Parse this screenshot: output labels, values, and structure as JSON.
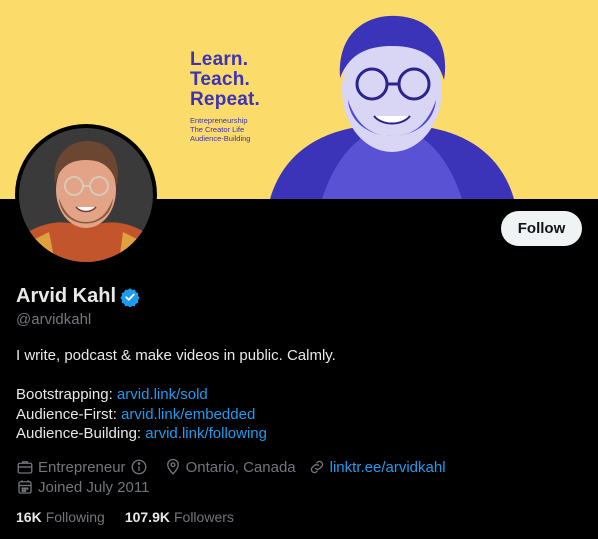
{
  "banner": {
    "headline": [
      "Learn.",
      "Teach.",
      "Repeat."
    ],
    "topics": [
      "Entrepreneurship",
      "The Creator Life",
      "Audience-Building"
    ],
    "colors": {
      "background": "#fbdb69",
      "accent": "#3b33b8"
    }
  },
  "profile": {
    "name": "Arvid Kahl",
    "handle": "@arvidkahl",
    "verified_icon": "verified-badge-icon",
    "follow_label": "Follow",
    "bio_line": "I write, podcast & make videos in public. Calmly.",
    "links": [
      {
        "label": "Bootstrapping:",
        "url": "arvid.link/sold"
      },
      {
        "label": "Audience-First:",
        "url": "arvid.link/embedded"
      },
      {
        "label": "Audience-Building:",
        "url": "arvid.link/following"
      }
    ],
    "category": "Entrepreneur",
    "location": "Ontario, Canada",
    "website": "linktr.ee/arvidkahl",
    "joined": "Joined July 2011",
    "following_count": "16K",
    "following_label": "Following",
    "followers_count": "107.9K",
    "followers_label": "Followers"
  },
  "colors": {
    "background": "#000000",
    "text": "#e7e9ea",
    "secondary": "#71767b",
    "link": "#1d9bf0",
    "button_bg": "#eff3f4"
  }
}
